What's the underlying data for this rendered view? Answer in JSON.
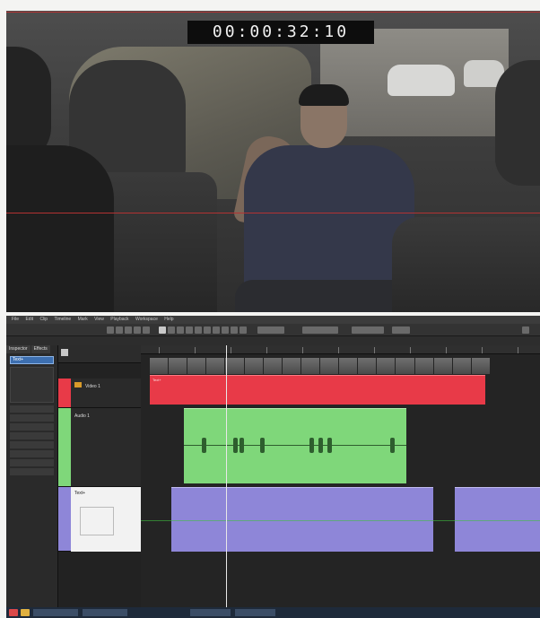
{
  "viewer": {
    "timecode": "00:00:32:10"
  },
  "editor": {
    "menu_items": [
      "File",
      "Edit",
      "Clip",
      "Timeline",
      "Mark",
      "View",
      "Playback",
      "Workspace",
      "Help"
    ],
    "left_panel": {
      "tabs": [
        "Inspector",
        "Effects"
      ],
      "node_label": "Text+"
    },
    "tracks": {
      "video_track": {
        "name": "Video 1",
        "clip_label": "Text+"
      },
      "audio_track": {
        "name": "Audio 1"
      },
      "text_track": {
        "name": "Text+"
      }
    }
  },
  "colors": {
    "red_clip": "#e83a48",
    "green_clip": "#7fd77a",
    "blue_clip": "#8e86d8",
    "timecode_bg": "#0d0d0d"
  }
}
